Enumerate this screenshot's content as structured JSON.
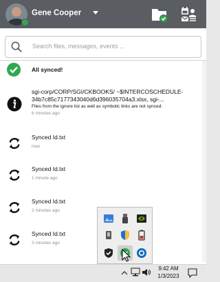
{
  "header": {
    "user_name": "Gene Cooper",
    "icons": [
      "avatar",
      "chevron-down-icon",
      "folder-synced-icon",
      "tools-icon"
    ]
  },
  "search": {
    "placeholder": "Search files, messages, events ..."
  },
  "status": {
    "text": "All synced!",
    "icon": "check-circle-icon",
    "color": "#2fa84f"
  },
  "activity": [
    {
      "type": "info",
      "title": "sgi-corp/CORP/SGI/CKBOOKS/ ~$INTERCOSCHEDULE-34b7c85c7177343040d6d396035704a3.xlsx, sgi-...",
      "message": "Files from the ignore list as well as symbolic links are not synced.",
      "time": "6 minutes ago"
    },
    {
      "type": "sync",
      "name": "Synced Id.txt",
      "time": "now"
    },
    {
      "type": "sync",
      "name": "Synced Id.txt",
      "time": "1 minute ago"
    },
    {
      "type": "sync",
      "name": "Synced Id.txt",
      "time": "2 minutes ago"
    },
    {
      "type": "sync",
      "name": "Synced Id.txt",
      "time": "3 minutes ago"
    }
  ],
  "taskbar": {
    "time": "9:42 AM",
    "date": "1/3/2023",
    "icons": [
      "chevron-up-icon",
      "network-icon",
      "volume-icon",
      "notification-icon"
    ]
  },
  "tray_overflow": {
    "icons": [
      "photos-icon",
      "usb-drive-icon",
      "nvidia-icon",
      "device-icon",
      "shield-icon",
      "battery-icon",
      "security-icon",
      "sync-client-icon",
      "outlook-icon"
    ]
  },
  "colors": {
    "header_bg": "#5a5d61",
    "accent_green": "#2fa84f",
    "outlook_blue": "#0f6cbd"
  }
}
